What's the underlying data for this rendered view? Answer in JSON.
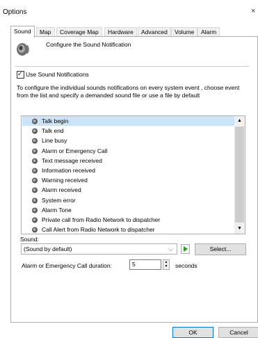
{
  "window": {
    "title": "Options",
    "close_glyph": "×"
  },
  "tabs": [
    "Sound",
    "Map",
    "Coverage Map",
    "Hardware",
    "Advanced",
    "Volume",
    "Alarm"
  ],
  "active_tab": "Sound",
  "header": {
    "text": "Configure the Sound Notification",
    "icon": "speaker-icon"
  },
  "use_notifications": {
    "label": "Use Sound Notifications",
    "checked": true
  },
  "description": "To configure the individual sounds notifications on every system event , choose event from the list and specify a demanded sound file or use a file by default",
  "events": {
    "selected_index": 0,
    "items": [
      "Talk begin",
      "Talk end",
      "Line busy",
      "Alarm or Emergency Call",
      "Text message received",
      "Information received",
      "Warning received",
      "Alarm received",
      "System error",
      "Alarm Tone",
      "Private call from Radio Network to dispatcher",
      "Call Alert from Radio Network to dispatcher"
    ]
  },
  "sound": {
    "label": "Sound:",
    "selected": "(Sound by default)",
    "select_button": "Select..."
  },
  "duration": {
    "label": "Alarm or Emergency Call duration:",
    "value": "5",
    "unit": "seconds"
  },
  "buttons": {
    "ok": "OK",
    "cancel": "Cancel"
  }
}
